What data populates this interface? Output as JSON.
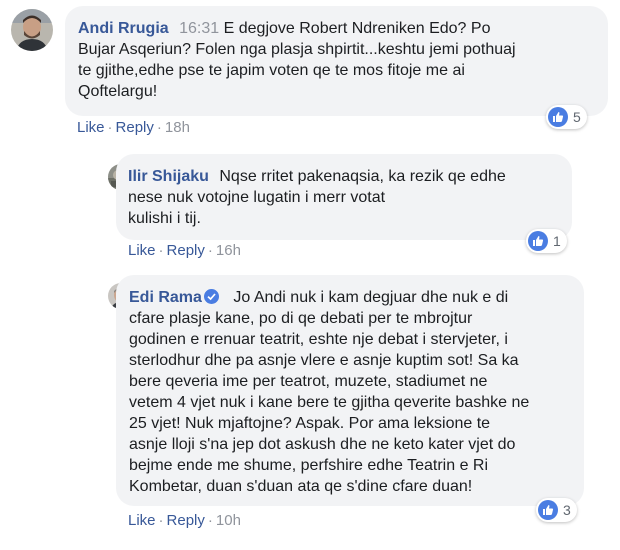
{
  "comments": [
    {
      "author": "Andi Rrugia",
      "timestamp": "16:31",
      "lines": [
        "E degjove Robert Ndreniken Edo? Po",
        "Bujar Asqeriun? Folen nga plasja shpirtit...keshtu jemi pothuaj",
        "te gjithe,edhe pse te japim voten qe te mos fitoje me ai",
        "Qoftelargu!"
      ],
      "like_label": "Like",
      "reply_label": "Reply",
      "age": "18h",
      "reaction_count": "5"
    },
    {
      "author": "Ilir Shijaku",
      "lines": [
        "Nqse rritet pakenaqsia, ka rezik qe edhe",
        "nese nuk votojne lugatin i merr votat",
        "kulishi i tij."
      ],
      "like_label": "Like",
      "reply_label": "Reply",
      "age": "16h",
      "reaction_count": "1"
    },
    {
      "author": "Edi Rama",
      "lines": [
        "Jo Andi nuk i kam degjuar dhe nuk e di",
        "cfare plasje kane, po di qe debati per te mbrojtur",
        "godinen e rrenuar teatrit, eshte nje debat i stervjeter, i",
        "sterlodhur dhe pa asnje vlere e asnje kuptim sot! Sa ka",
        "bere qeveria ime per teatrot, muzete, stadiumet ne",
        "vetem 4 vjet nuk i kane bere te gjitha qeverite bashke ne",
        "25 vjet! Nuk mjaftojne? Aspak. Por ama leksione te",
        "asnje lloji s'na jep dot askush dhe ne keto kater vjet do",
        "bejme ende me shume, perfshire edhe Teatrin e Ri",
        "Kombetar, duan s'duan ata qe s'dine cfare duan!"
      ],
      "like_label": "Like",
      "reply_label": "Reply",
      "age": "10h",
      "reaction_count": "3"
    }
  ],
  "colors": {
    "link": "#385898",
    "meta": "#90949c",
    "bubble": "#f2f3f5",
    "like_blue": "#4a7de2"
  }
}
